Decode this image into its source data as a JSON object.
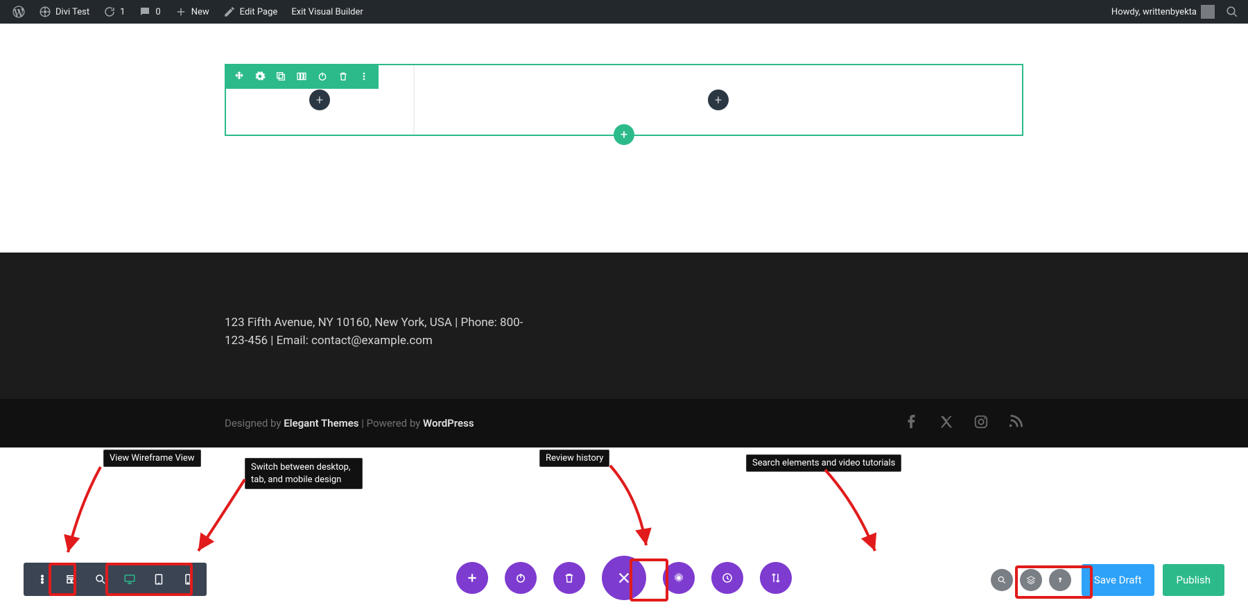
{
  "adminbar": {
    "site_title": "Divi Test",
    "updates": "1",
    "comments": "0",
    "new": "New",
    "edit_page": "Edit Page",
    "exit_vb": "Exit Visual Builder",
    "howdy_prefix": "Howdy, ",
    "user": "writtenbyekta"
  },
  "section_toolbar_icons": [
    "move",
    "gear",
    "duplicate",
    "columns",
    "power",
    "trash",
    "more"
  ],
  "footer": {
    "address": "123 Fifth Avenue, NY 10160, New York, USA | Phone: 800-123-456 | Email: contact@example.com"
  },
  "credit": {
    "designed_by": "Designed by",
    "theme": "Elegant Themes",
    "sep": " | ",
    "powered_by": "Powered by",
    "platform": "WordPress"
  },
  "bottombar": {
    "save_draft": "Save Draft",
    "publish": "Publish"
  },
  "tooltips": {
    "wireframe": "View Wireframe View",
    "responsive": "Switch between desktop, tab, and mobile design",
    "history": "Review history",
    "search": "Search elements and video tutorials"
  },
  "colors": {
    "teal": "#2cba8b",
    "purple": "#7e3bd0",
    "blue": "#2ea2f8",
    "dark": "#1c1c1c",
    "red": "#e11b1b"
  }
}
